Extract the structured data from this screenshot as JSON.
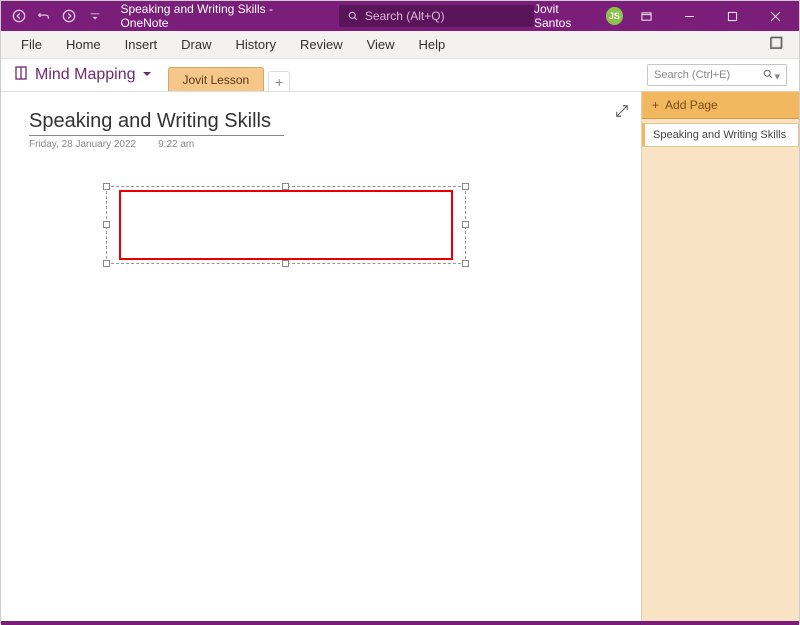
{
  "titlebar": {
    "title": "Speaking and Writing Skills  -  OneNote",
    "search_placeholder": "Search (Alt+Q)",
    "user_name": "Jovit Santos",
    "user_initials": "JS"
  },
  "menubar": {
    "items": [
      "File",
      "Home",
      "Insert",
      "Draw",
      "History",
      "Review",
      "View",
      "Help"
    ]
  },
  "notebook": {
    "name": "Mind Mapping",
    "section_tab": "Jovit Lesson",
    "page_search_placeholder": "Search (Ctrl+E)"
  },
  "page": {
    "title": "Speaking and Writing Skills",
    "date": "Friday, 28 January 2022",
    "time": "9:22 am"
  },
  "pagepanel": {
    "add_page_label": "Add Page",
    "pages": [
      "Speaking and Writing Skills"
    ]
  }
}
